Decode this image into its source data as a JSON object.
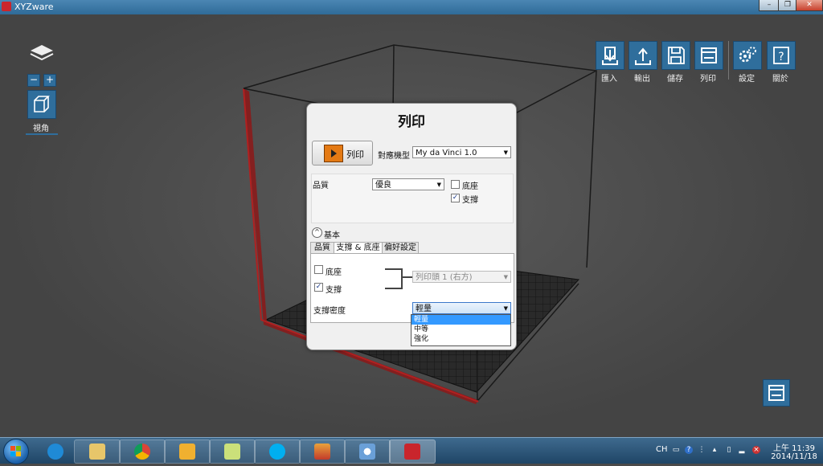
{
  "window": {
    "title": "XYZware",
    "minimize": "–",
    "maximize": "❐",
    "close": "✕"
  },
  "left_tools": {
    "zoom_out": "−",
    "zoom_in": "+",
    "view_label": "視角"
  },
  "toolbar": [
    {
      "id": "import",
      "label": "匯入",
      "icon": "import-icon"
    },
    {
      "id": "export",
      "label": "輸出",
      "icon": "export-icon"
    },
    {
      "id": "save",
      "label": "儲存",
      "icon": "save-icon"
    },
    {
      "id": "print",
      "label": "列印",
      "icon": "print-icon"
    },
    {
      "id": "settings",
      "label": "設定",
      "icon": "gear-icon"
    },
    {
      "id": "about",
      "label": "關於",
      "icon": "help-icon"
    }
  ],
  "dialog": {
    "title": "列印",
    "print_button": "列印",
    "printer_label": "對應機型",
    "printer_value": "My da Vinci 1.0",
    "quality_label": "品質",
    "quality_value": "優良",
    "raft_label": "底座",
    "raft_checked": false,
    "support_label": "支撐",
    "support_checked": true,
    "expander_symbol": "^",
    "basic_label": "基本",
    "tabs": [
      "品質",
      "支撐 & 底座",
      "偏好設定"
    ],
    "active_tab": 1,
    "panel": {
      "raft_label": "底座",
      "raft_checked": false,
      "support_label": "支撐",
      "support_checked": true,
      "extruder_value": "列印頭 1 (右方)",
      "density_label": "支撐密度",
      "density_value": "輕量",
      "density_options": [
        "輕量",
        "中等",
        "強化"
      ],
      "density_selected": 0
    }
  },
  "taskbar": {
    "lang": "CH",
    "time": "上午 11:39",
    "date": "2014/11/18",
    "apps": [
      "ie-icon",
      "file-explorer-icon",
      "chrome-icon",
      "outlook-icon",
      "folder-icon",
      "skype-icon",
      "xyz-slicer-icon",
      "paint-icon",
      "xyzware-icon"
    ]
  },
  "colors": {
    "accent_blue": "#2f6e9c",
    "brand_red": "#c9252c",
    "dropdown_highlight": "#3399ff"
  }
}
